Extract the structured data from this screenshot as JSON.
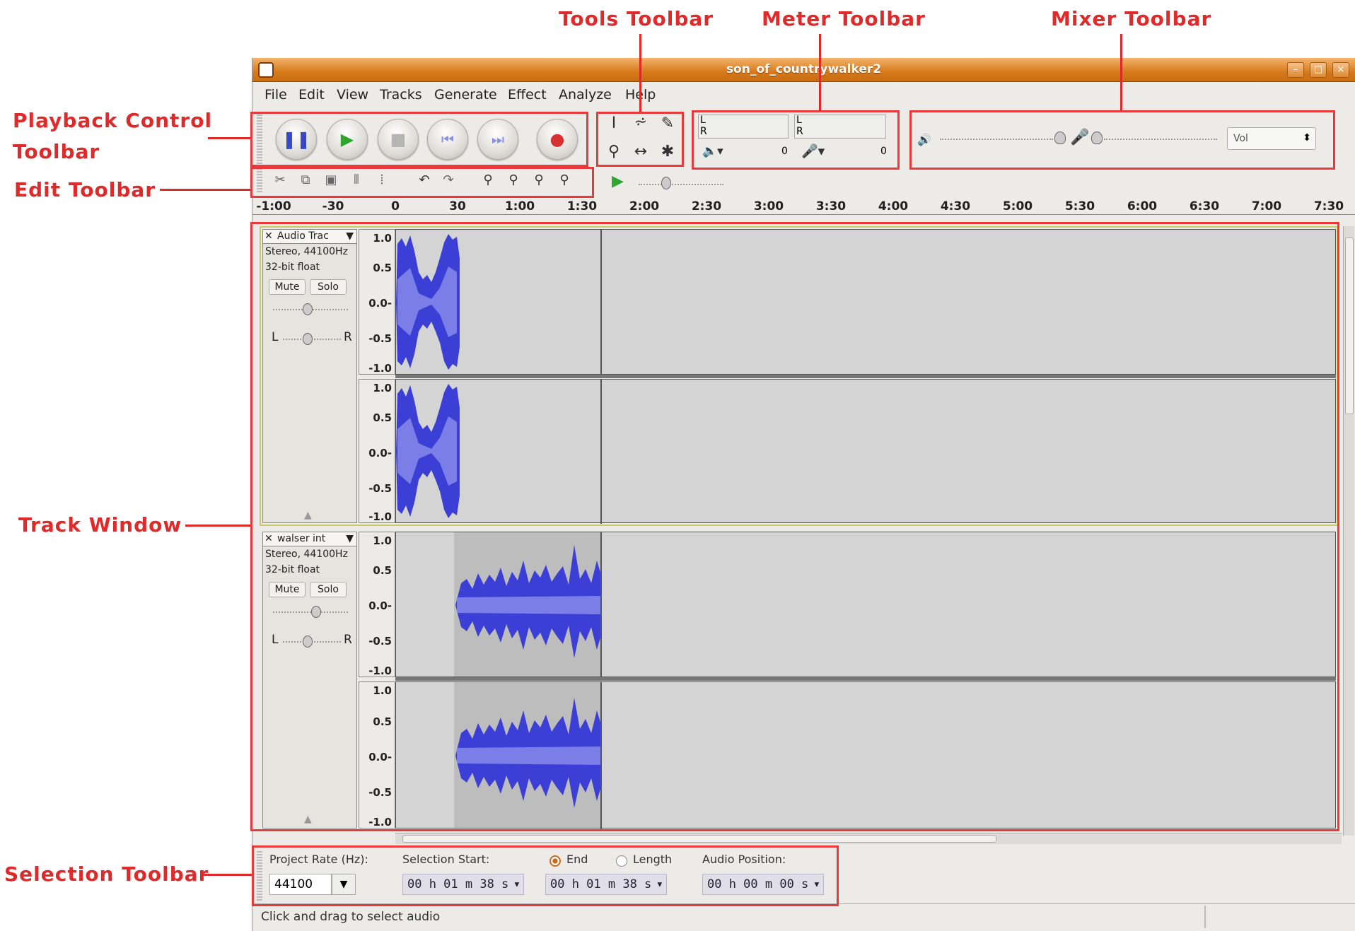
{
  "annotations": {
    "tools": "Tools Toolbar",
    "meter": "Meter Toolbar",
    "mixer": "Mixer Toolbar",
    "playback_1": "Playback Control",
    "playback_2": "Toolbar",
    "edit": "Edit Toolbar",
    "track_window": "Track Window",
    "selection": "Selection Toolbar"
  },
  "window": {
    "title": "son_of_countrywalker2",
    "menus": [
      "File",
      "Edit",
      "View",
      "Tracks",
      "Generate",
      "Effect",
      "Analyze",
      "Help"
    ]
  },
  "meter": {
    "left_zero": "0",
    "right_zero": "0",
    "l": "L",
    "r": "R"
  },
  "mixer": {
    "selector": "Vol"
  },
  "ruler": [
    "-1:00",
    "-30",
    "0",
    "30",
    "1:00",
    "1:30",
    "2:00",
    "2:30",
    "3:00",
    "3:30",
    "4:00",
    "4:30",
    "5:00",
    "5:30",
    "6:00",
    "6:30",
    "7:00",
    "7:30"
  ],
  "tracks": [
    {
      "name": "Audio Trac",
      "format": "Stereo, 44100Hz",
      "bits": "32-bit float",
      "mute": "Mute",
      "solo": "Solo",
      "pan_left": "L",
      "pan_right": "R"
    },
    {
      "name": "walser int",
      "format": "Stereo, 44100Hz",
      "bits": "32-bit float",
      "mute": "Mute",
      "solo": "Solo",
      "pan_left": "L",
      "pan_right": "R"
    }
  ],
  "vruler_labels": [
    "1.0",
    "0.5",
    "0.0-",
    "-0.5",
    "-1.0"
  ],
  "selection_bar": {
    "project_rate_label": "Project Rate (Hz):",
    "project_rate": "44100",
    "selection_start_label": "Selection Start:",
    "selection_start": "00 h 01 m 38 s",
    "end_label": "End",
    "length_label": "Length",
    "end_value": "00 h 01 m 38 s",
    "audio_position_label": "Audio Position:",
    "audio_position": "00 h 00 m 00 s"
  },
  "status": "Click and drag to select audio",
  "colors": {
    "waveform": "#3b3fd6",
    "waveform_light": "#7a7ee6",
    "annotation": "#e02a2a",
    "titlebar": "#d77a1c"
  }
}
